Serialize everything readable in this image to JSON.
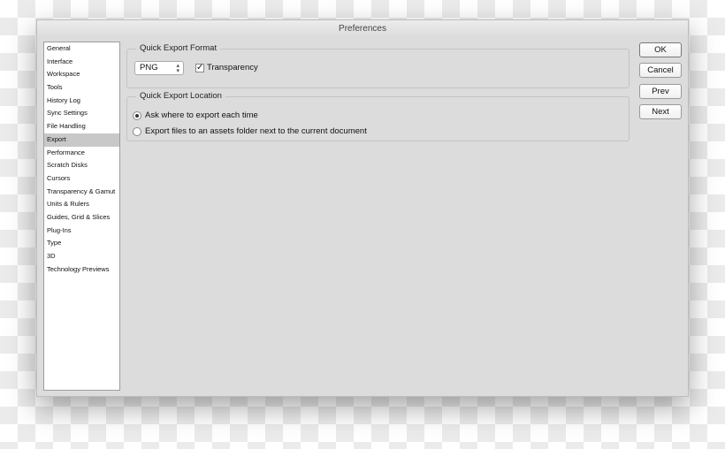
{
  "window": {
    "title": "Preferences"
  },
  "sidebar": {
    "items": [
      "General",
      "Interface",
      "Workspace",
      "Tools",
      "History Log",
      "Sync Settings",
      "File Handling",
      "Export",
      "Performance",
      "Scratch Disks",
      "Cursors",
      "Transparency & Gamut",
      "Units & Rulers",
      "Guides, Grid & Slices",
      "Plug-Ins",
      "Type",
      "3D",
      "Technology Previews"
    ],
    "selected": "Export"
  },
  "format": {
    "legend": "Quick Export Format",
    "format_value": "PNG",
    "transparency_label": "Transparency",
    "transparency_checked": true
  },
  "location": {
    "legend": "Quick Export Location",
    "option_ask": "Ask where to export each time",
    "option_assets": "Export files to an assets folder next to the current document",
    "selected": "Ask where to export each time"
  },
  "buttons": {
    "ok": "OK",
    "cancel": "Cancel",
    "prev": "Prev",
    "next": "Next"
  }
}
